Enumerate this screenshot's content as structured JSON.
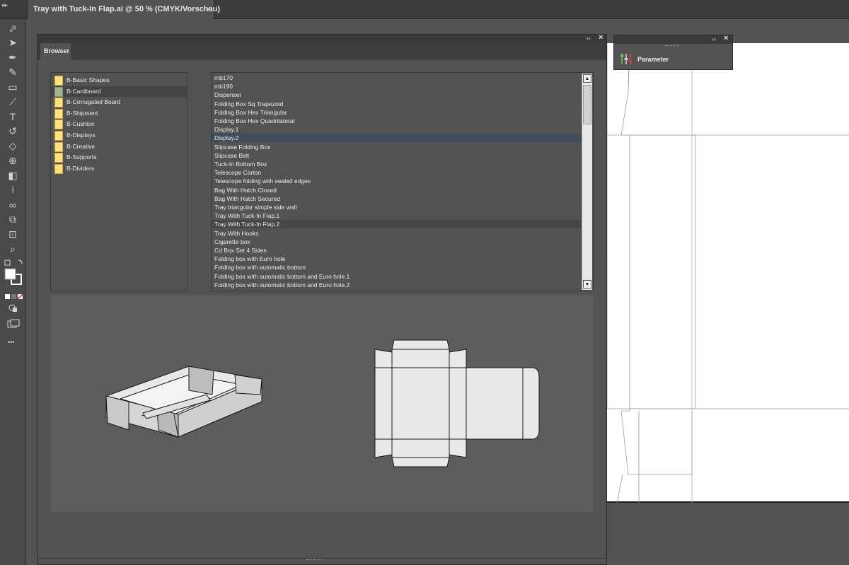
{
  "document_tab": {
    "title": "Tray with Tuck-In Flap.ai @ 50 % (CMYK/Vorschau)",
    "close_glyph": "×"
  },
  "toolbar": {
    "tools": [
      {
        "icon": "selection-arrow-icon",
        "glyph": "⬀"
      },
      {
        "icon": "direct-selection-icon",
        "glyph": "➤"
      },
      {
        "icon": "pen-tool-icon",
        "glyph": "✒"
      },
      {
        "icon": "curvature-tool-icon",
        "glyph": "✎"
      },
      {
        "icon": "rectangle-tool-icon",
        "glyph": "▭"
      },
      {
        "icon": "paintbrush-icon",
        "glyph": "⟋"
      },
      {
        "icon": "type-tool-icon",
        "glyph": "T"
      },
      {
        "icon": "rotate-tool-icon",
        "glyph": "↺"
      },
      {
        "icon": "eraser-icon",
        "glyph": "◇"
      },
      {
        "icon": "shape-builder-icon",
        "glyph": "⊕"
      },
      {
        "icon": "gradient-icon",
        "glyph": "◧"
      },
      {
        "icon": "eyedropper-icon",
        "glyph": "⟊"
      },
      {
        "icon": "blend-tool-icon",
        "glyph": "∞"
      },
      {
        "icon": "symbol-sprayer-icon",
        "glyph": "⧉"
      },
      {
        "icon": "artboard-tool-icon",
        "glyph": "⊡"
      },
      {
        "icon": "zoom-icon",
        "glyph": "⌕"
      }
    ],
    "more_glyph": "•••"
  },
  "browser_panel": {
    "tab_label": "Browser",
    "collapse_glyph": "‹‹",
    "close_glyph": "×",
    "categories": [
      {
        "label": "B-Basic Shapes",
        "selected": false
      },
      {
        "label": "B-Cardboard",
        "selected": true
      },
      {
        "label": "B-Corrugated Board",
        "selected": false
      },
      {
        "label": "B-Shipment",
        "selected": false
      },
      {
        "label": "B-Cushion",
        "selected": false
      },
      {
        "label": "B-Displays",
        "selected": false
      },
      {
        "label": "B-Creative",
        "selected": false
      },
      {
        "label": "B-Supports",
        "selected": false
      },
      {
        "label": "B-Dividers",
        "selected": false
      }
    ],
    "templates": [
      {
        "label": "mb170",
        "state": ""
      },
      {
        "label": "mb190",
        "state": ""
      },
      {
        "label": "Dispenser",
        "state": ""
      },
      {
        "label": "Folding Box Sq Trapezoid",
        "state": ""
      },
      {
        "label": "Folding Box Hex Triangular",
        "state": ""
      },
      {
        "label": "Folding Box Hex Quadrilateral",
        "state": ""
      },
      {
        "label": "Display.1",
        "state": ""
      },
      {
        "label": "Display.2",
        "state": "hover"
      },
      {
        "label": "Slipcase Folding Box",
        "state": ""
      },
      {
        "label": "Slipcase Belt",
        "state": ""
      },
      {
        "label": "Tuck-In Bottom Box",
        "state": ""
      },
      {
        "label": "Telescope Carton",
        "state": ""
      },
      {
        "label": "Telescope folding with sealed edges",
        "state": ""
      },
      {
        "label": "Bag With Hatch Closed",
        "state": ""
      },
      {
        "label": "Bag With Hatch Secured",
        "state": ""
      },
      {
        "label": "Tray triangular simple side wall",
        "state": ""
      },
      {
        "label": "Tray With Tuck-In Flap.1",
        "state": ""
      },
      {
        "label": "Tray With Tuck-In Flap.2",
        "state": "sel"
      },
      {
        "label": "Tray With Hooks",
        "state": ""
      },
      {
        "label": "Cigarette box",
        "state": ""
      },
      {
        "label": "Cd Box Set 4 Sides",
        "state": ""
      },
      {
        "label": "Folding box with Euro hole",
        "state": ""
      },
      {
        "label": "Folding box with automatic bottom",
        "state": ""
      },
      {
        "label": "Folding box with automatic bottom and Euro hole.1",
        "state": ""
      },
      {
        "label": "Folding box with automatic bottom and Euro hole.2",
        "state": ""
      }
    ]
  },
  "parameter_panel": {
    "title": "Parameter",
    "expand_glyph": "››",
    "close_glyph": "×"
  },
  "colors": {
    "ui_bg": "#535353",
    "folder": "#ffe27a",
    "folder_selected": "#a3b48e",
    "hover_row": "#3f4d5a",
    "canvas": "#ffffff"
  }
}
